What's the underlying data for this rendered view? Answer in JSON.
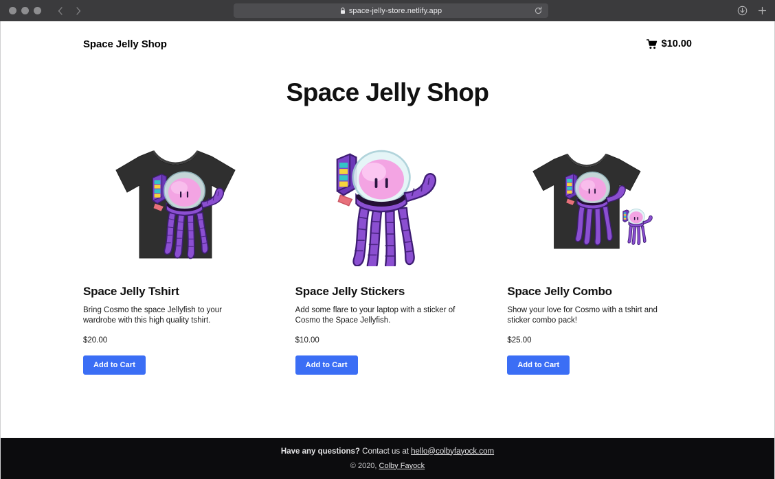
{
  "browser": {
    "url": "space-jelly-store.netlify.app",
    "lock_icon": "lock-icon",
    "reload_icon": "reload-icon",
    "back_icon": "chevron-left-icon",
    "forward_icon": "chevron-right-icon",
    "download_icon": "download-icon",
    "new_tab_icon": "plus-icon",
    "traffic_lights": [
      "close",
      "minimize",
      "maximize"
    ]
  },
  "header": {
    "brand": "Space Jelly Shop",
    "cart_icon": "shopping-cart-icon",
    "cart_total": "$10.00"
  },
  "main": {
    "title": "Space Jelly Shop",
    "add_to_cart_label": "Add to Cart",
    "products": [
      {
        "name": "Space Jelly Tshirt",
        "description": "Bring Cosmo the space Jellyfish to your wardrobe with this high quality tshirt.",
        "price": "$20.00",
        "image": "tshirt-jellyfish"
      },
      {
        "name": "Space Jelly Stickers",
        "description": "Add some flare to your laptop with a sticker of Cosmo the Space Jellyfish.",
        "price": "$10.00",
        "image": "sticker-jellyfish"
      },
      {
        "name": "Space Jelly Combo",
        "description": "Show your love for Cosmo with a tshirt and sticker combo pack!",
        "price": "$25.00",
        "image": "tshirt-and-sticker-combo"
      }
    ]
  },
  "footer": {
    "questions_bold": "Have any questions?",
    "contact_text": " Contact us at ",
    "email": "hello@colbyfayock.com",
    "copyright_prefix": "© 2020, ",
    "author": "Colby Fayock"
  },
  "colors": {
    "accent_blue": "#3b6ef5",
    "footer_bg": "#0c0c0e",
    "chrome_bg": "#3b3b3d",
    "jelly_purple": "#8b4fd1",
    "jelly_head_pink": "#f2a3e0",
    "shirt_black": "#2e2e2e"
  }
}
